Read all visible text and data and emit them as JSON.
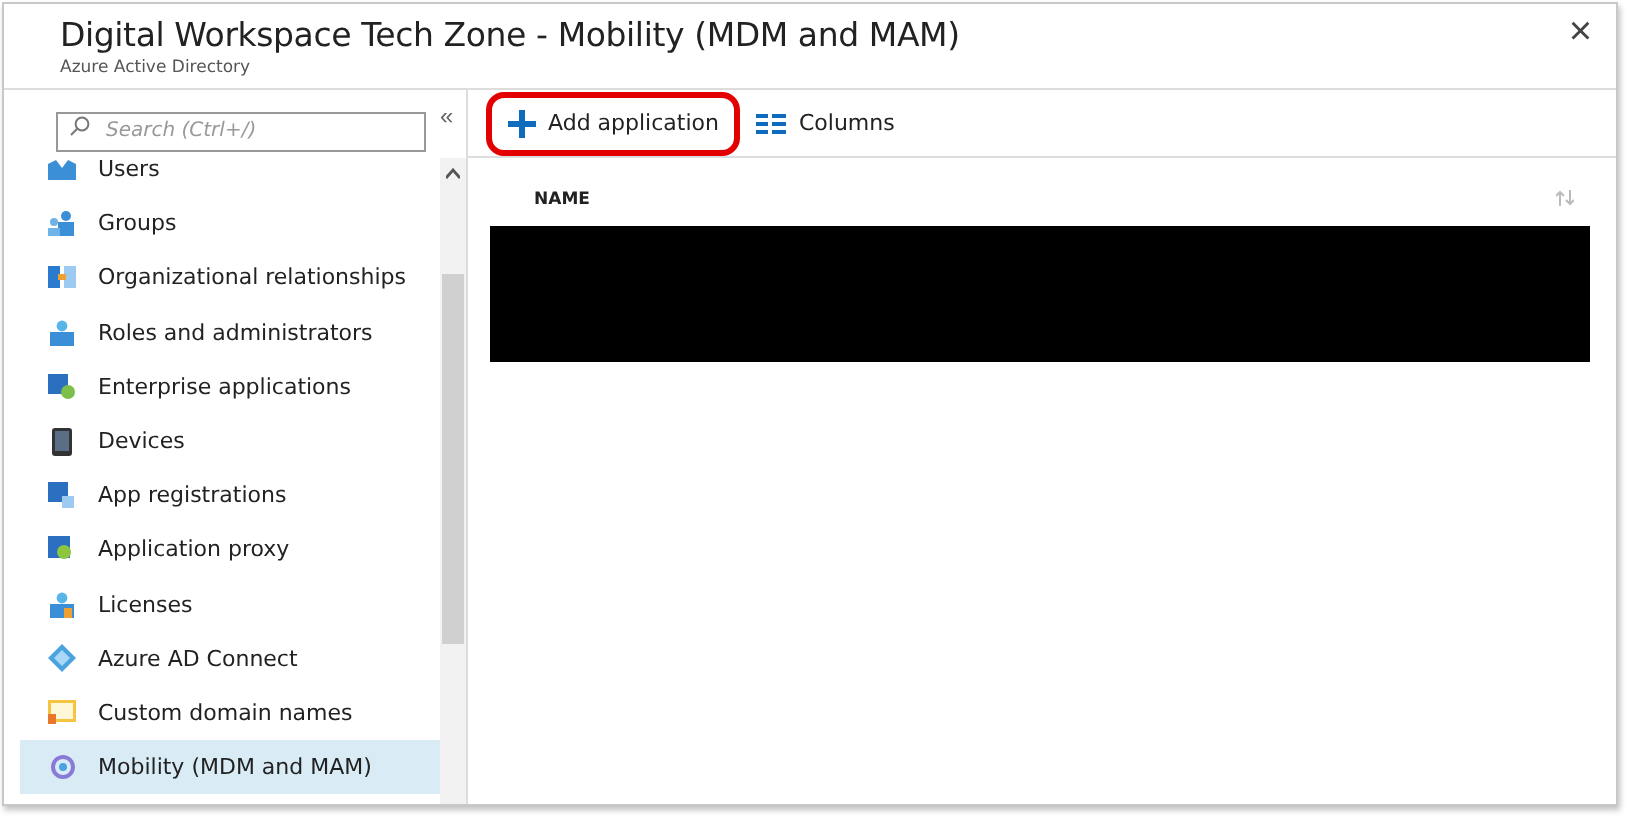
{
  "window": {
    "title": "Digital Workspace Tech Zone - Mobility (MDM and MAM)",
    "subtitle": "Azure Active Directory",
    "close": "×"
  },
  "sidebar": {
    "search": {
      "placeholder": "Search (Ctrl+/)"
    },
    "collapse": "«",
    "items": [
      {
        "label": "Users",
        "selected": false
      },
      {
        "label": "Groups",
        "selected": false
      },
      {
        "label": "Organizational relationships",
        "selected": false
      },
      {
        "label": "Roles and administrators",
        "selected": false
      },
      {
        "label": "Enterprise applications",
        "selected": false
      },
      {
        "label": "Devices",
        "selected": false
      },
      {
        "label": "App registrations",
        "selected": false
      },
      {
        "label": "Application proxy",
        "selected": false
      },
      {
        "label": "Licenses",
        "selected": false
      },
      {
        "label": "Azure AD Connect",
        "selected": false
      },
      {
        "label": "Custom domain names",
        "selected": false
      },
      {
        "label": "Mobility (MDM and MAM)",
        "selected": true
      }
    ]
  },
  "toolbar": [
    {
      "kind": "add",
      "label": "Add application",
      "highlighted": true
    },
    {
      "kind": "columns",
      "label": "Columns",
      "highlighted": false
    }
  ],
  "table": {
    "columns": [
      {
        "label": "NAME"
      }
    ]
  }
}
